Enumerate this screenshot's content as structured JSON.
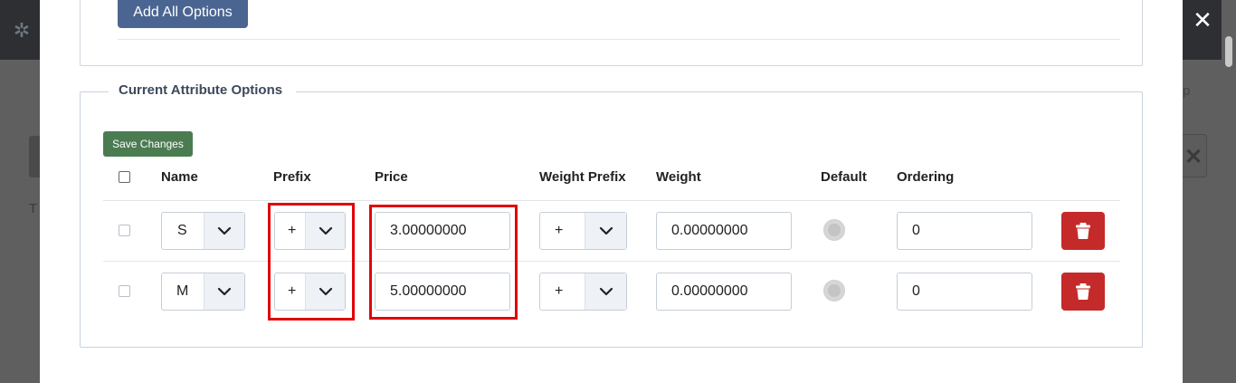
{
  "modal": {
    "close_symbol": "✕",
    "add_all_options_label": "Add All Options"
  },
  "current_options": {
    "legend": "Current Attribute Options",
    "save_changes_label": "Save Changes",
    "columns": [
      "Name",
      "Prefix",
      "Price",
      "Weight Prefix",
      "Weight",
      "Default",
      "Ordering"
    ],
    "rows": [
      {
        "name": "S",
        "prefix": "+",
        "price": "3.00000000",
        "weight_prefix": "+",
        "weight": "0.00000000",
        "default": false,
        "ordering": "0"
      },
      {
        "name": "M",
        "prefix": "+",
        "price": "5.00000000",
        "weight_prefix": "+",
        "weight": "0.00000000",
        "default": false,
        "ordering": "0"
      }
    ]
  },
  "icons": {
    "close": "close-icon",
    "chevron": "chevron-down-icon",
    "trash": "trash-icon",
    "logo": "joomla-logo-icon"
  },
  "colors": {
    "primary_button": "#4a6591",
    "save_button": "#4b7c51",
    "delete_button": "#c52a2a",
    "highlight": "#e0050b"
  }
}
